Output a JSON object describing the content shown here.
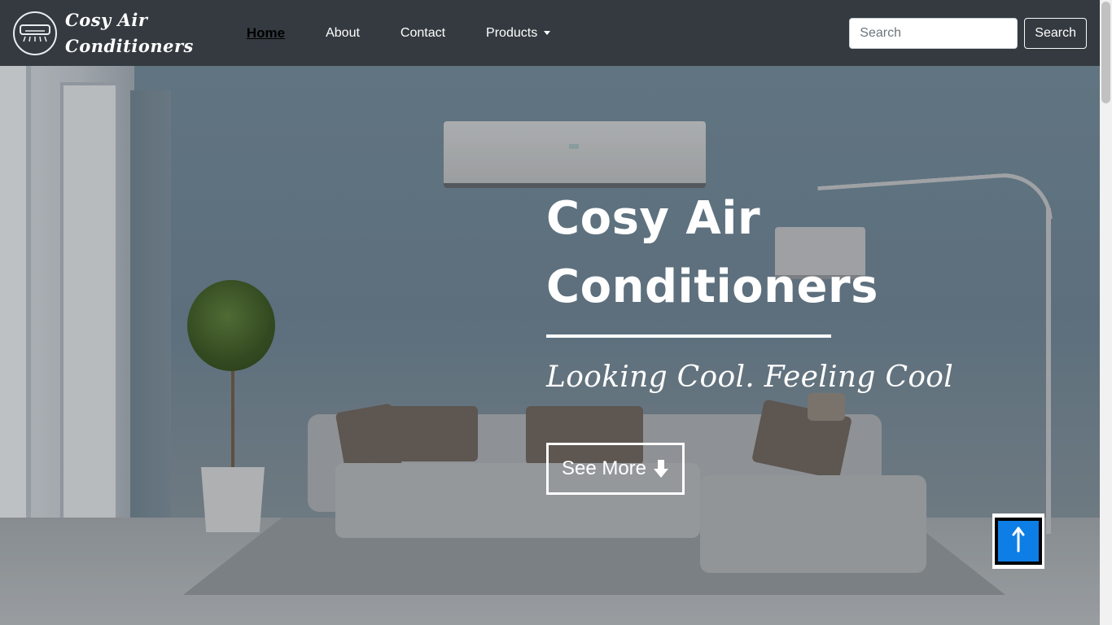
{
  "brand": {
    "line1": "Cosy Air",
    "line2": "Conditioners",
    "logo_icon": "air-conditioner-icon"
  },
  "nav": {
    "home": "Home",
    "about": "About",
    "contact": "Contact",
    "products": "Products"
  },
  "search": {
    "placeholder": "Search",
    "button_label": "Search"
  },
  "hero": {
    "title": "Cosy Air Conditioners",
    "tagline": "Looking Cool. Feeling Cool",
    "see_more_label": "See More",
    "see_more_icon": "arrow-down-icon"
  },
  "back_to_top": {
    "icon": "arrow-up-icon",
    "color": "#0d7ee5"
  },
  "colors": {
    "navbar": "#343a40",
    "text": "#ffffff"
  }
}
